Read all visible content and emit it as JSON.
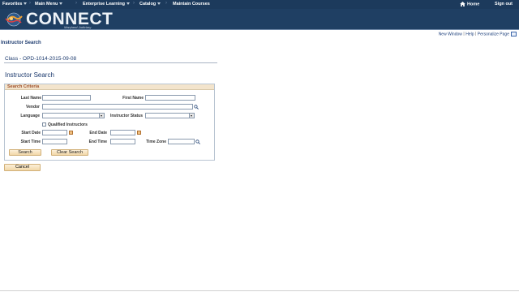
{
  "topnav": {
    "items": [
      {
        "label": "Favorites"
      },
      {
        "label": "Main Menu"
      },
      {
        "label": "Enterprise Learning"
      },
      {
        "label": "Catalog"
      },
      {
        "label": "Maintain Courses"
      }
    ],
    "home_label": "Home",
    "signout_label": "Sign out"
  },
  "banner": {
    "logo_text": "CONNECT",
    "logo_subtitle": "Maryland Judiciary"
  },
  "utility": {
    "new_window": "New Window",
    "help": "Help",
    "personalize": "Personalize Page"
  },
  "page": {
    "title": "Instructor Search",
    "class_label": "Class - OPD-1014-2015-09-08",
    "section_title": "Instructor Search"
  },
  "criteria": {
    "header": "Search Criteria",
    "last_name_label": "Last Name",
    "last_name_value": "",
    "first_name_label": "First Name",
    "first_name_value": "",
    "vendor_label": "Vendor",
    "vendor_value": "",
    "language_label": "Language",
    "language_value": "",
    "instructor_status_label": "Instructor Status",
    "instructor_status_value": "",
    "qualified_label": "Qualified Instructors",
    "qualified_checked": false,
    "start_date_label": "Start Date",
    "start_date_value": "",
    "end_date_label": "End Date",
    "end_date_value": "",
    "start_time_label": "Start Time",
    "start_time_value": "",
    "end_time_label": "End Time",
    "end_time_value": "",
    "time_zone_label": "Time Zone",
    "time_zone_value": "",
    "search_button": "Search",
    "clear_button": "Clear Search"
  },
  "actions": {
    "cancel_button": "Cancel"
  },
  "colors": {
    "nav_bg": "#1c3a5c",
    "banner_bg": "#1f3f63",
    "title_blue": "#1c3a6e",
    "section_header_bg": "#f3e4cc",
    "button_bg": "#f1d7a8"
  }
}
